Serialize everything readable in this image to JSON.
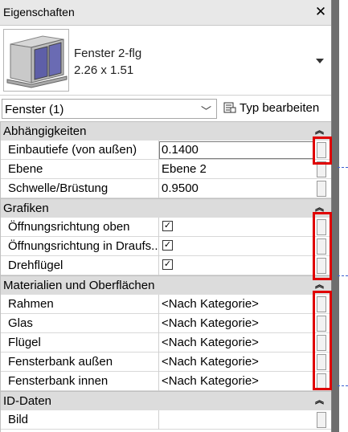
{
  "panel": {
    "title": "Eigenschaften",
    "close_label": "✕"
  },
  "type_selector": {
    "family": "Fenster 2-flg",
    "size": "2.26 x 1.51"
  },
  "filter": {
    "selected": "Fenster (1)",
    "edit_type_label": "Typ bearbeiten"
  },
  "categories": [
    {
      "label": "Abhängigkeiten",
      "rows": [
        {
          "name": "Einbautiefe (von außen)",
          "value": "0.1400",
          "kind": "edit"
        },
        {
          "name": "Ebene",
          "value": "Ebene 2",
          "kind": "text"
        },
        {
          "name": "Schwelle/Brüstung",
          "value": "0.9500",
          "kind": "text"
        }
      ]
    },
    {
      "label": "Grafiken",
      "rows": [
        {
          "name": "Öffnungsrichtung oben",
          "value": true,
          "kind": "check"
        },
        {
          "name": "Öffnungsrichtung in Draufs...",
          "value": true,
          "kind": "check"
        },
        {
          "name": "Drehflügel",
          "value": true,
          "kind": "check"
        }
      ]
    },
    {
      "label": "Materialien und Oberflächen",
      "rows": [
        {
          "name": "Rahmen",
          "value": "<Nach Kategorie>",
          "kind": "text"
        },
        {
          "name": "Glas",
          "value": "<Nach Kategorie>",
          "kind": "text"
        },
        {
          "name": "Flügel",
          "value": "<Nach Kategorie>",
          "kind": "text"
        },
        {
          "name": "Fensterbank außen",
          "value": "<Nach Kategorie>",
          "kind": "text"
        },
        {
          "name": "Fensterbank innen",
          "value": "<Nach Kategorie>",
          "kind": "text"
        }
      ]
    },
    {
      "label": "ID-Daten",
      "rows": [
        {
          "name": "Bild",
          "value": "",
          "kind": "text"
        }
      ]
    }
  ],
  "colors": {
    "highlight": "#e00000",
    "category_bg": "#dcdcdc",
    "dashed_line": "#3a5fd0"
  }
}
